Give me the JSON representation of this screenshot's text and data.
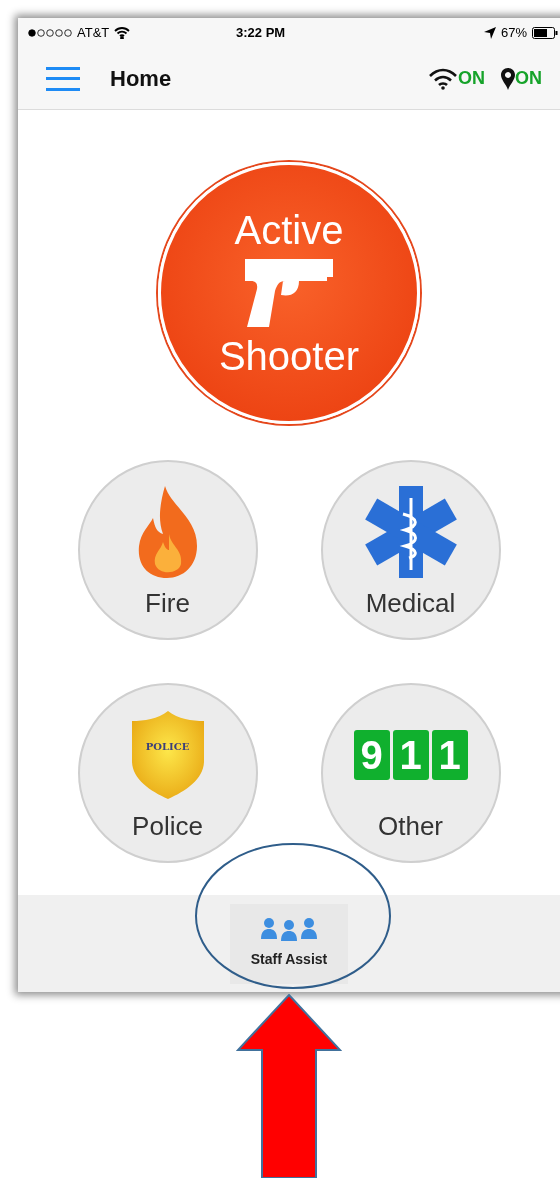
{
  "status_bar": {
    "carrier": "AT&T",
    "time": "3:22 PM",
    "battery": "67%"
  },
  "header": {
    "title": "Home",
    "wifi_status": "ON",
    "location_status": "ON"
  },
  "main_alert": {
    "kind": "active_shooter",
    "lines": [
      "Active",
      "Shooter"
    ]
  },
  "alerts": [
    {
      "kind": "fire",
      "label": "Fire"
    },
    {
      "kind": "medical",
      "label": "Medical"
    },
    {
      "kind": "police",
      "label": "Police",
      "badge_text": "POLICE"
    },
    {
      "kind": "other",
      "label": "Other",
      "digits": [
        "9",
        "1",
        "1"
      ]
    }
  ],
  "footer": {
    "button": "Staff Assist"
  }
}
